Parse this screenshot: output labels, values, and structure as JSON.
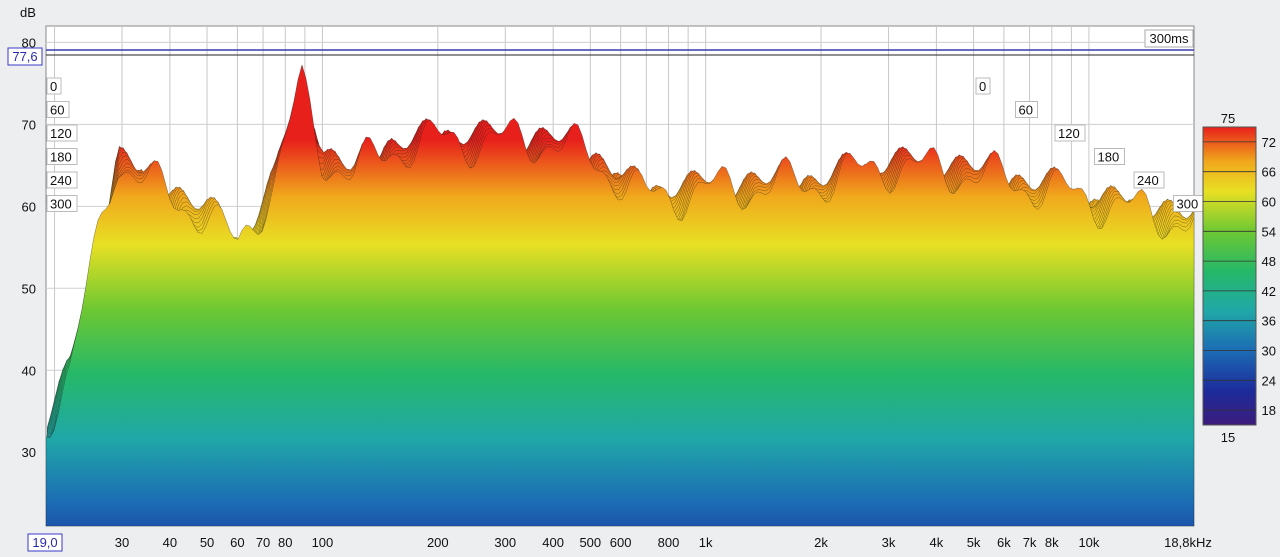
{
  "chart_data": {
    "type": "waterfall",
    "y_unit": "dB",
    "ylim": [
      21,
      82
    ],
    "y_ticks": [
      80,
      70,
      60,
      50,
      40,
      30
    ],
    "cursor_value": "77,6",
    "x_start_label": "19,0",
    "x_unit_label": "18,8kHz",
    "x_ticks": [
      {
        "label": "30",
        "f": 30
      },
      {
        "label": "40",
        "f": 40
      },
      {
        "label": "50",
        "f": 50
      },
      {
        "label": "60",
        "f": 60
      },
      {
        "label": "70",
        "f": 70
      },
      {
        "label": "80",
        "f": 80
      },
      {
        "label": "100",
        "f": 100
      },
      {
        "label": "200",
        "f": 200
      },
      {
        "label": "300",
        "f": 300
      },
      {
        "label": "400",
        "f": 400
      },
      {
        "label": "500",
        "f": 500
      },
      {
        "label": "600",
        "f": 600
      },
      {
        "label": "800",
        "f": 800
      },
      {
        "label": "1k",
        "f": 1000
      },
      {
        "label": "2k",
        "f": 2000
      },
      {
        "label": "3k",
        "f": 3000
      },
      {
        "label": "4k",
        "f": 4000
      },
      {
        "label": "5k",
        "f": 5000
      },
      {
        "label": "6k",
        "f": 6000
      },
      {
        "label": "7k",
        "f": 7000
      },
      {
        "label": "8k",
        "f": 8000
      },
      {
        "label": "10k",
        "f": 10000
      }
    ],
    "xlim_hz": [
      19,
      18800
    ],
    "time_label": "300ms",
    "time_slices_ms": [
      0,
      60,
      120,
      180,
      240,
      300
    ],
    "envelope_points": [
      {
        "f": 19,
        "db": 34
      },
      {
        "f": 22,
        "db": 40
      },
      {
        "f": 26,
        "db": 56
      },
      {
        "f": 29,
        "db": 66
      },
      {
        "f": 33,
        "db": 64
      },
      {
        "f": 40,
        "db": 61
      },
      {
        "f": 50,
        "db": 59
      },
      {
        "f": 60,
        "db": 55
      },
      {
        "f": 75,
        "db": 63
      },
      {
        "f": 88,
        "db": 75
      },
      {
        "f": 100,
        "db": 66
      },
      {
        "f": 120,
        "db": 64
      },
      {
        "f": 150,
        "db": 67
      },
      {
        "f": 200,
        "db": 68
      },
      {
        "f": 300,
        "db": 68
      },
      {
        "f": 400,
        "db": 68
      },
      {
        "f": 500,
        "db": 66
      },
      {
        "f": 700,
        "db": 61
      },
      {
        "f": 1000,
        "db": 62
      },
      {
        "f": 2000,
        "db": 63
      },
      {
        "f": 3000,
        "db": 65
      },
      {
        "f": 5000,
        "db": 64
      },
      {
        "f": 8000,
        "db": 62
      },
      {
        "f": 18000,
        "db": 58
      }
    ],
    "colorbar": {
      "top_label": "75",
      "bottom_label": "15",
      "ticks": [
        "72",
        "66",
        "60",
        "54",
        "48",
        "42",
        "36",
        "30",
        "24",
        "18"
      ],
      "stops": [
        {
          "db": 75,
          "color": "#e8201c"
        },
        {
          "db": 68,
          "color": "#f0a81c"
        },
        {
          "db": 62,
          "color": "#e8e024"
        },
        {
          "db": 54,
          "color": "#6ec832"
        },
        {
          "db": 46,
          "color": "#26b868"
        },
        {
          "db": 38,
          "color": "#20a8a8"
        },
        {
          "db": 30,
          "color": "#1c6cb4"
        },
        {
          "db": 22,
          "color": "#1c2c9c"
        },
        {
          "db": 15,
          "color": "#3c1c7c"
        }
      ]
    }
  }
}
